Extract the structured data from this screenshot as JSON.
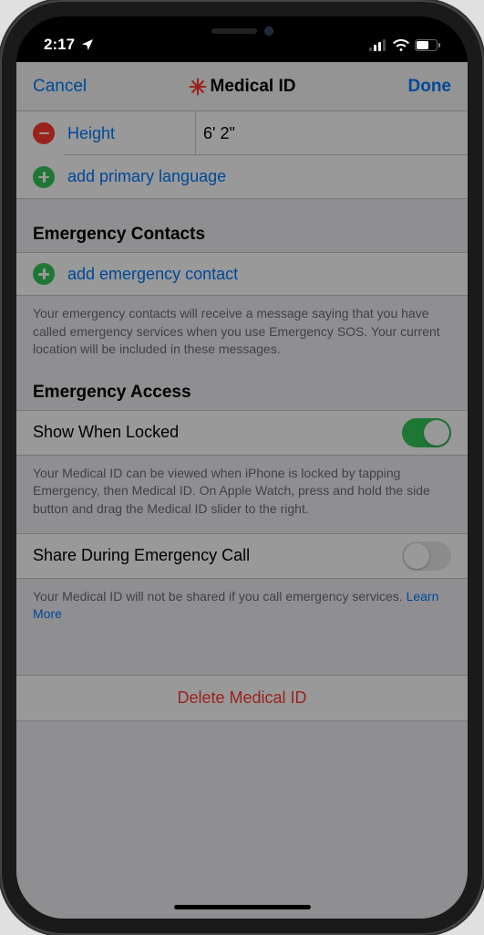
{
  "status": {
    "time": "2:17",
    "signal": 2,
    "wifi": true,
    "battery": 55
  },
  "nav": {
    "cancel": "Cancel",
    "title": "Medical ID",
    "done": "Done"
  },
  "height_row": {
    "label": "Height",
    "value": "6' 2\""
  },
  "add_language": "add primary language",
  "emergency_contacts": {
    "header": "Emergency Contacts",
    "add": "add emergency contact",
    "footer": "Your emergency contacts will receive a message saying that you have called emergency services when you use Emergency SOS. Your current location will be included in these messages."
  },
  "emergency_access": {
    "header": "Emergency Access",
    "show_locked": {
      "label": "Show When Locked",
      "on": true,
      "footer": "Your Medical ID can be viewed when iPhone is locked by tapping Emergency, then Medical ID. On Apple Watch, press and hold the side button and drag the Medical ID slider to the right."
    },
    "share_call": {
      "label": "Share During Emergency Call",
      "on": false,
      "footer": "Your Medical ID will not be shared if you call emergency services. ",
      "learn_more": "Learn More"
    }
  },
  "delete": "Delete Medical ID"
}
